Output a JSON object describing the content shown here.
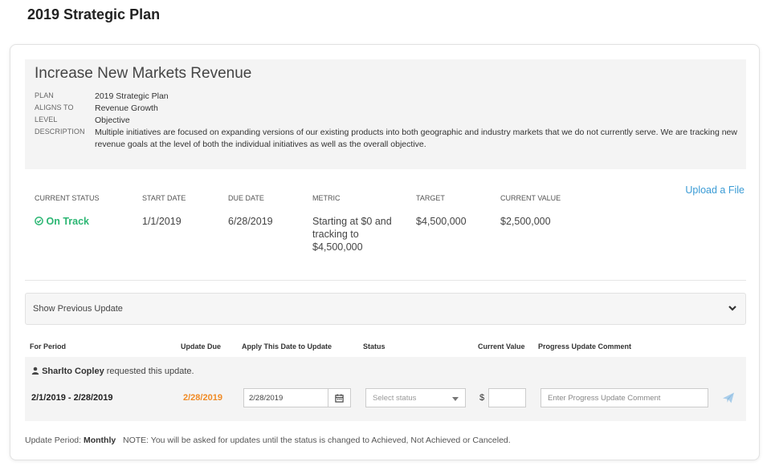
{
  "page": {
    "title": "2019 Strategic Plan"
  },
  "objective": {
    "title": "Increase New Markets Revenue",
    "meta": [
      {
        "key": "PLAN",
        "value": "2019 Strategic Plan"
      },
      {
        "key": "ALIGNS TO",
        "value": "Revenue Growth"
      },
      {
        "key": "LEVEL",
        "value": "Objective"
      },
      {
        "key": "DESCRIPTION",
        "value": "Multiple initiatives are focused on expanding versions of our existing products into both geographic and industry markets that we do not currently serve. We are tracking new revenue goals at the level of both the individual initiatives as well as the overall objective."
      }
    ]
  },
  "stats": {
    "current_status_label": "CURRENT STATUS",
    "current_status_value": "On Track",
    "start_date_label": "START DATE",
    "start_date_value": "1/1/2019",
    "due_date_label": "DUE DATE",
    "due_date_value": "6/28/2019",
    "metric_label": "METRIC",
    "metric_value": "Starting at $0 and tracking to $4,500,000",
    "target_label": "TARGET",
    "target_value": "$4,500,000",
    "current_value_label": "CURRENT VALUE",
    "current_value_value": "$2,500,000",
    "upload_link": "Upload a File"
  },
  "previous_update": {
    "label": "Show Previous Update"
  },
  "table": {
    "headers": [
      "For Period",
      "Update Due",
      "Apply This Date to Update",
      "Status",
      "Current Value",
      "Progress Update Comment"
    ]
  },
  "update_row": {
    "requester_name": "Sharlto Copley",
    "requester_suffix": " requested this update.",
    "period": "2/1/2019 - 2/28/2019",
    "update_due": "2/28/2019",
    "apply_date": "2/28/2019",
    "status_placeholder": "Select status",
    "currency": "$",
    "current_value": "",
    "comment_placeholder": "Enter Progress Update Comment"
  },
  "footer": {
    "period_label": "Update Period: ",
    "period_value": "Monthly",
    "note": "NOTE: You will be asked for updates until the status is changed to Achieved, Not Achieved or Canceled."
  },
  "colors": {
    "on_track": "#2bb673",
    "due": "#f08a24",
    "link": "#3a9bd5"
  },
  "icons": [
    "check-circle-icon",
    "user-icon",
    "calendar-icon",
    "chevron-down-icon",
    "send-icon"
  ]
}
